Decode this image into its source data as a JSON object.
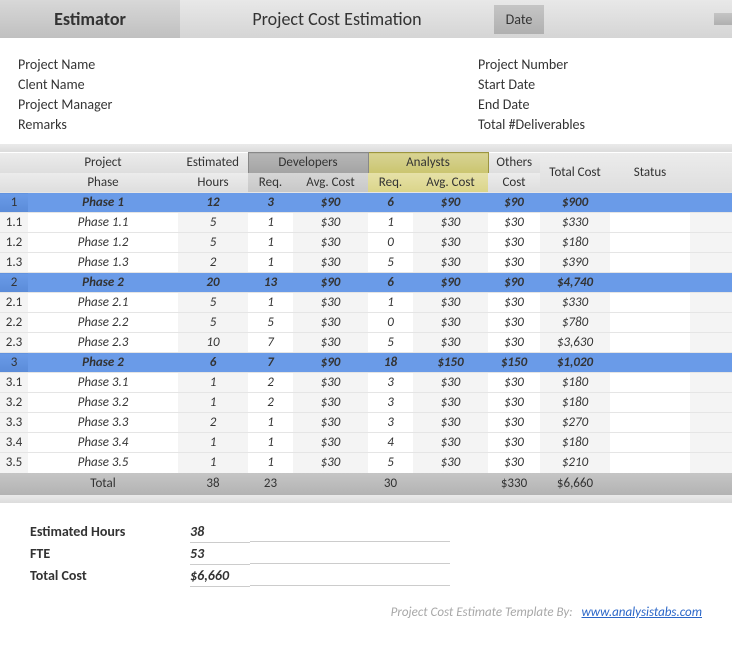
{
  "header": {
    "estimator": "Estimator",
    "title": "Project Cost Estimation",
    "date_label": "Date"
  },
  "meta": {
    "left": [
      {
        "label": "Project Name",
        "value": ""
      },
      {
        "label": "Clent Name",
        "value": ""
      },
      {
        "label": "Project Manager",
        "value": ""
      },
      {
        "label": "Remarks",
        "value": ""
      }
    ],
    "right": [
      {
        "label": "Project Number",
        "value": ""
      },
      {
        "label": "Start Date",
        "value": ""
      },
      {
        "label": "End Date",
        "value": ""
      },
      {
        "label": "Total #Deliverables",
        "value": ""
      }
    ]
  },
  "table_head": {
    "project": "Project",
    "phase": "Phase",
    "estimated": "Estimated",
    "hours": "Hours",
    "developers": "Developers",
    "analysts": "Analysts",
    "others": "Others",
    "cost": "Cost",
    "req": "Req.",
    "avg_cost": "Avg. Cost",
    "total_cost": "Total Cost",
    "status": "Status"
  },
  "rows": [
    {
      "type": "summary",
      "idx": "1",
      "phase": "Phase 1",
      "est": "12",
      "dreq": "3",
      "davg": "$90",
      "areq": "6",
      "aavg": "$90",
      "others": "$90",
      "total": "$900",
      "status": ""
    },
    {
      "type": "detail",
      "idx": "1.1",
      "phase": "Phase 1.1",
      "est": "5",
      "dreq": "1",
      "davg": "$30",
      "areq": "1",
      "aavg": "$30",
      "others": "$30",
      "total": "$330",
      "status": ""
    },
    {
      "type": "detail",
      "idx": "1.2",
      "phase": "Phase 1.2",
      "est": "5",
      "dreq": "1",
      "davg": "$30",
      "areq": "0",
      "aavg": "$30",
      "others": "$30",
      "total": "$180",
      "status": ""
    },
    {
      "type": "detail",
      "idx": "1.3",
      "phase": "Phase 1.3",
      "est": "2",
      "dreq": "1",
      "davg": "$30",
      "areq": "5",
      "aavg": "$30",
      "others": "$30",
      "total": "$390",
      "status": ""
    },
    {
      "type": "summary",
      "idx": "2",
      "phase": "Phase 2",
      "est": "20",
      "dreq": "13",
      "davg": "$90",
      "areq": "6",
      "aavg": "$90",
      "others": "$90",
      "total": "$4,740",
      "status": ""
    },
    {
      "type": "detail",
      "idx": "2.1",
      "phase": "Phase 2.1",
      "est": "5",
      "dreq": "1",
      "davg": "$30",
      "areq": "1",
      "aavg": "$30",
      "others": "$30",
      "total": "$330",
      "status": ""
    },
    {
      "type": "detail",
      "idx": "2.2",
      "phase": "Phase 2.2",
      "est": "5",
      "dreq": "5",
      "davg": "$30",
      "areq": "0",
      "aavg": "$30",
      "others": "$30",
      "total": "$780",
      "status": ""
    },
    {
      "type": "detail",
      "idx": "2.3",
      "phase": "Phase 2.3",
      "est": "10",
      "dreq": "7",
      "davg": "$30",
      "areq": "5",
      "aavg": "$30",
      "others": "$30",
      "total": "$3,630",
      "status": ""
    },
    {
      "type": "summary",
      "idx": "3",
      "phase": "Phase 2",
      "est": "6",
      "dreq": "7",
      "davg": "$90",
      "areq": "18",
      "aavg": "$150",
      "others": "$150",
      "total": "$1,020",
      "status": ""
    },
    {
      "type": "detail",
      "idx": "3.1",
      "phase": "Phase 3.1",
      "est": "1",
      "dreq": "2",
      "davg": "$30",
      "areq": "3",
      "aavg": "$30",
      "others": "$30",
      "total": "$180",
      "status": ""
    },
    {
      "type": "detail",
      "idx": "3.2",
      "phase": "Phase 3.2",
      "est": "1",
      "dreq": "2",
      "davg": "$30",
      "areq": "3",
      "aavg": "$30",
      "others": "$30",
      "total": "$180",
      "status": ""
    },
    {
      "type": "detail",
      "idx": "3.3",
      "phase": "Phase 3.3",
      "est": "2",
      "dreq": "1",
      "davg": "$30",
      "areq": "3",
      "aavg": "$30",
      "others": "$30",
      "total": "$270",
      "status": ""
    },
    {
      "type": "detail",
      "idx": "3.4",
      "phase": "Phase 3.4",
      "est": "1",
      "dreq": "1",
      "davg": "$30",
      "areq": "4",
      "aavg": "$30",
      "others": "$30",
      "total": "$180",
      "status": ""
    },
    {
      "type": "detail",
      "idx": "3.5",
      "phase": "Phase 3.5",
      "est": "1",
      "dreq": "1",
      "davg": "$30",
      "areq": "5",
      "aavg": "$30",
      "others": "$30",
      "total": "$210",
      "status": ""
    }
  ],
  "totals": {
    "label": "Total",
    "est": "38",
    "dreq": "23",
    "areq": "30",
    "others": "$330",
    "total": "$6,660"
  },
  "summary_box": {
    "est_hours_label": "Estimated Hours",
    "est_hours_val": "38",
    "fte_label": "FTE",
    "fte_val": "53",
    "total_cost_label": "Total Cost",
    "total_cost_val": "$6,660"
  },
  "footer": {
    "text": "Project Cost Estimate Template By:",
    "link": "www.analysistabs.com"
  }
}
